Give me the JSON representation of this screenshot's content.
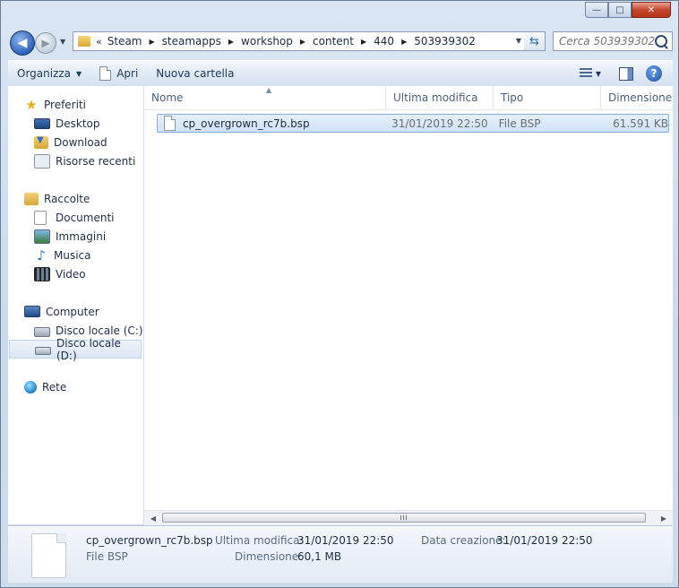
{
  "window": {
    "caption": {
      "minimize": "—",
      "maximize": "□",
      "close": "✕"
    }
  },
  "nav": {
    "overflow": "«",
    "breadcrumb": [
      "Steam",
      "steamapps",
      "workshop",
      "content",
      "440",
      "503939302"
    ],
    "search_placeholder": "Cerca 503939302"
  },
  "toolbar": {
    "organize": "Organizza",
    "open": "Apri",
    "new_folder": "Nuova cartella"
  },
  "sidebar": {
    "favorites": {
      "label": "Preferiti",
      "items": [
        "Desktop",
        "Download",
        "Risorse recenti"
      ]
    },
    "libraries": {
      "label": "Raccolte",
      "items": [
        "Documenti",
        "Immagini",
        "Musica",
        "Video"
      ]
    },
    "computer": {
      "label": "Computer",
      "items": [
        "Disco locale (C:)",
        "Disco locale (D:)"
      ],
      "selected": "Disco locale (D:)"
    },
    "network": {
      "label": "Rete"
    }
  },
  "columns": [
    "Nome",
    "Ultima modifica",
    "Tipo",
    "Dimensione"
  ],
  "files": [
    {
      "name": "cp_overgrown_rc7b.bsp",
      "modified": "31/01/2019 22:50",
      "type": "File BSP",
      "size": "61.591 KB"
    }
  ],
  "details": {
    "name": "cp_overgrown_rc7b.bsp",
    "type": "File BSP",
    "modified_label": "Ultima modifica:",
    "modified": "31/01/2019 22:50",
    "size_label": "Dimensione:",
    "size": "60,1 MB",
    "created_label": "Data creazione:",
    "created": "31/01/2019 22:50"
  }
}
